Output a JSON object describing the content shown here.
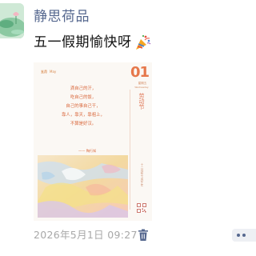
{
  "post": {
    "author_name": "静思荷品",
    "message": "五一假期愉快呀",
    "message_icon": "party-popper-icon",
    "timestamp": "2026年5月1日 09:27"
  },
  "calendar_card": {
    "month_label": "五月",
    "month_en": "May",
    "day": "01",
    "weekday": "星期五",
    "weekday_en": "Wednesday",
    "poem_lines": [
      "滴自己的汗，",
      "吃自己的饭，",
      "自己的事自己干，",
      "靠人，靠天，靠祖上，",
      "不算是好汉。"
    ],
    "poem_author": "—— 陶行知",
    "vertical_title": "劳动节",
    "vertical_small": "十二月初七 丙午年"
  },
  "actions": {
    "delete_icon": "trash-icon",
    "more_icon": "more-dots-icon"
  },
  "colors": {
    "nickname": "#56688f",
    "timestamp": "#a8a8a8",
    "accent": "#e6784b"
  }
}
